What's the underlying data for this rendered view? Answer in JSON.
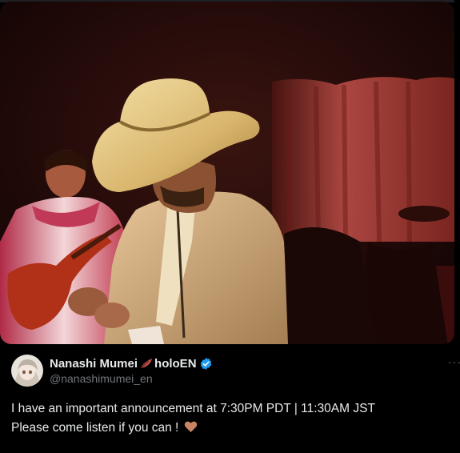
{
  "tweet": {
    "display_name": "Nanashi Mumei",
    "name_suffix": "holoEN",
    "handle": "@nanashimumei_en",
    "text_line1": "I have an important announcement at 7:30PM PDT | 11:30AM JST",
    "text_line2": "Please come listen if you can !",
    "more_label": "···"
  },
  "icons": {
    "feather": "feather-icon",
    "verified": "verified-badge-icon",
    "heart": "heart-emoji-icon",
    "more": "more-options-icon"
  },
  "colors": {
    "background": "#000000",
    "text_primary": "#e7e9ea",
    "text_secondary": "#71767b",
    "verified_blue": "#1d9bf0",
    "heart": "#c98561"
  }
}
